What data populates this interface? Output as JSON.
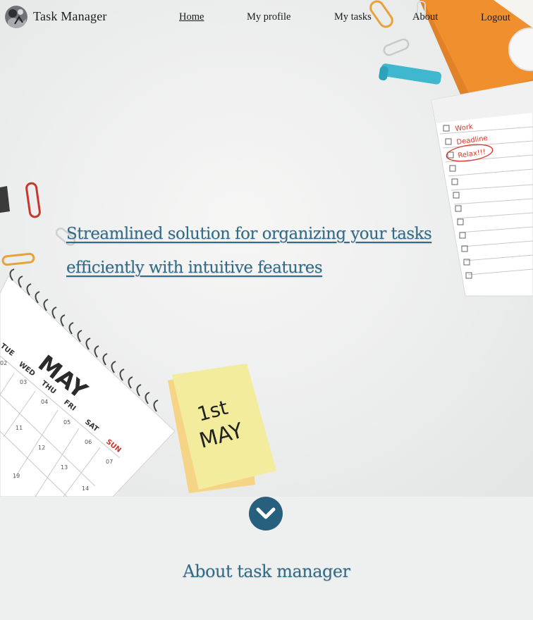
{
  "brand": {
    "name": "Task Manager"
  },
  "nav": {
    "home": "Home",
    "profile": "My profile",
    "tasks": "My tasks",
    "about": "About",
    "logout": "Logout"
  },
  "hero": {
    "tagline": "Streamlined solution for organizing your tasks efficiently with intuitive features",
    "calendar_month": "MAY",
    "calendar_days": [
      "TUE",
      "WED",
      "THU",
      "FRI",
      "SAT",
      "SUN"
    ],
    "calendar_dates": [
      "02",
      "03",
      "04",
      "05",
      "06",
      "07",
      "11",
      "12",
      "13",
      "14",
      "19"
    ],
    "sticky_note_line1": "1st",
    "sticky_note_line2": "MAY",
    "checklist_items": [
      "Work",
      "Deadline",
      "Relax!!!"
    ]
  },
  "about": {
    "title": "About task manager"
  },
  "colors": {
    "accent": "#2f6b8a",
    "button": "#275f7e",
    "sticky": "#f3ec9c",
    "clip_orange": "#e7a23a",
    "clip_red": "#c8372d"
  },
  "icons": {
    "scroll": "chevron-down-icon"
  }
}
